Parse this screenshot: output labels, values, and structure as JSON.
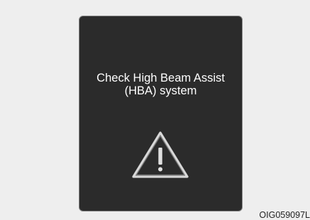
{
  "display": {
    "message_line1": "Check High Beam Assist",
    "message_line2": "(HBA) system",
    "icon": "warning-triangle-icon",
    "background_color": "#2b2b2b",
    "text_color": "#ffffff"
  },
  "caption": {
    "code": "OIG059097L"
  }
}
